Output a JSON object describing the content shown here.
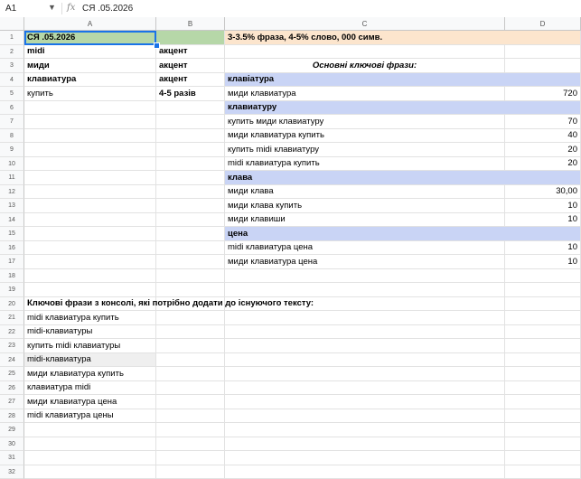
{
  "formula_bar": {
    "cell_ref": "A1",
    "value": "СЯ .05.2026"
  },
  "column_headers": [
    "A",
    "B",
    "C",
    "D"
  ],
  "row_count": 32,
  "colors": {
    "green": "#b6d7a8",
    "peach": "#fce5cd",
    "blue": "#c9d4f5",
    "hover": "#efefef"
  },
  "cells": [
    {
      "r": 1,
      "c": "A",
      "v": "СЯ .05.2026",
      "bold": true,
      "bg": "green"
    },
    {
      "r": 1,
      "c": "B",
      "v": "",
      "bg": "green"
    },
    {
      "r": 1,
      "c": "C",
      "v": "3-3.5% фраза, 4-5% слово, 000 симв.",
      "bold": true,
      "bg": "peach",
      "span": 2
    },
    {
      "r": 2,
      "c": "A",
      "v": "midi",
      "bold": true
    },
    {
      "r": 2,
      "c": "B",
      "v": "акцент",
      "bold": true
    },
    {
      "r": 3,
      "c": "A",
      "v": "миди",
      "bold": true
    },
    {
      "r": 3,
      "c": "B",
      "v": "акцент",
      "bold": true
    },
    {
      "r": 3,
      "c": "C",
      "v": "Основні ключові фрази:",
      "bold": true,
      "italic": true,
      "center": true
    },
    {
      "r": 4,
      "c": "A",
      "v": "клавиатура",
      "bold": true
    },
    {
      "r": 4,
      "c": "B",
      "v": "акцент",
      "bold": true
    },
    {
      "r": 4,
      "c": "C",
      "v": "клавіатура",
      "bold": true,
      "bg": "blue",
      "span": 2
    },
    {
      "r": 5,
      "c": "A",
      "v": "купить"
    },
    {
      "r": 5,
      "c": "B",
      "v": "4-5 разів",
      "bold": true
    },
    {
      "r": 5,
      "c": "C",
      "v": "миди клавиатура"
    },
    {
      "r": 5,
      "c": "D",
      "v": "720",
      "right": true
    },
    {
      "r": 6,
      "c": "C",
      "v": "клавиатуру",
      "bold": true,
      "bg": "blue",
      "span": 2
    },
    {
      "r": 7,
      "c": "C",
      "v": "купить миди клавиатуру"
    },
    {
      "r": 7,
      "c": "D",
      "v": "70",
      "right": true
    },
    {
      "r": 8,
      "c": "C",
      "v": "миди клавиатура купить"
    },
    {
      "r": 8,
      "c": "D",
      "v": "40",
      "right": true
    },
    {
      "r": 9,
      "c": "C",
      "v": "купить midi клавиатуру"
    },
    {
      "r": 9,
      "c": "D",
      "v": "20",
      "right": true
    },
    {
      "r": 10,
      "c": "C",
      "v": "midi клавиатура купить"
    },
    {
      "r": 10,
      "c": "D",
      "v": "20",
      "right": true
    },
    {
      "r": 11,
      "c": "C",
      "v": "клава",
      "bold": true,
      "bg": "blue",
      "span": 2
    },
    {
      "r": 12,
      "c": "C",
      "v": "миди клава"
    },
    {
      "r": 12,
      "c": "D",
      "v": "30,00",
      "right": true
    },
    {
      "r": 13,
      "c": "C",
      "v": "миди клава купить"
    },
    {
      "r": 13,
      "c": "D",
      "v": "10",
      "right": true
    },
    {
      "r": 14,
      "c": "C",
      "v": "миди клавиши"
    },
    {
      "r": 14,
      "c": "D",
      "v": "10",
      "right": true
    },
    {
      "r": 15,
      "c": "C",
      "v": "цена",
      "bold": true,
      "bg": "blue",
      "span": 2
    },
    {
      "r": 16,
      "c": "C",
      "v": "midi клавиатура цена"
    },
    {
      "r": 16,
      "c": "D",
      "v": "10",
      "right": true
    },
    {
      "r": 17,
      "c": "C",
      "v": "миди клавиатура цена"
    },
    {
      "r": 17,
      "c": "D",
      "v": "10",
      "right": true
    },
    {
      "r": 20,
      "c": "A",
      "v": "Ключові фрази з консолі, які потрібно додати до існуючого тексту:",
      "bold": true
    },
    {
      "r": 21,
      "c": "A",
      "v": "midi клавиатура купить"
    },
    {
      "r": 22,
      "c": "A",
      "v": "midi-клавиатуры"
    },
    {
      "r": 23,
      "c": "A",
      "v": "купить midi клавиатуры"
    },
    {
      "r": 24,
      "c": "A",
      "v": "midi-клавиатура",
      "bg": "hover"
    },
    {
      "r": 25,
      "c": "A",
      "v": "миди клавиатура купить"
    },
    {
      "r": 26,
      "c": "A",
      "v": "клавиатура midi"
    },
    {
      "r": 27,
      "c": "A",
      "v": "миди клавиатура цена"
    },
    {
      "r": 28,
      "c": "A",
      "v": "midi клавиатура цены"
    }
  ]
}
